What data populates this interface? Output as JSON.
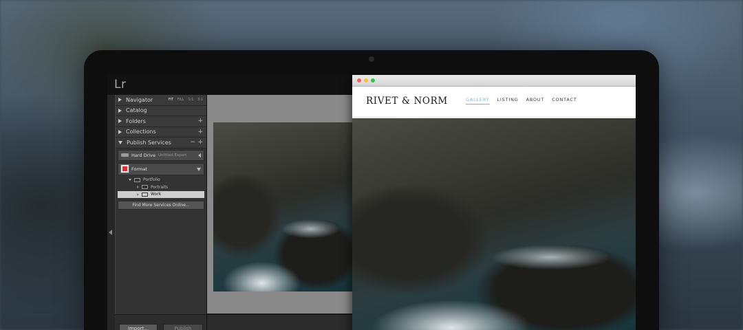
{
  "lightroom": {
    "logo": "Lr",
    "navigator": {
      "label": "Navigator",
      "options": [
        "FIT",
        "FILL",
        "1:1",
        "3:1"
      ]
    },
    "sections": [
      {
        "label": "Catalog",
        "action": ""
      },
      {
        "label": "Folders",
        "action": "+"
      },
      {
        "label": "Collections",
        "action": "+"
      }
    ],
    "publish": {
      "label": "Publish Services",
      "actions": [
        "−",
        "+"
      ],
      "hard_drive": {
        "name": "Hard Drive",
        "subtitle": "Untitled Export"
      },
      "format": {
        "name": "Format"
      },
      "tree": [
        {
          "label": "Portfolio",
          "level": 1,
          "selected": false
        },
        {
          "label": "Portraits",
          "level": 2,
          "selected": false
        },
        {
          "label": "Work",
          "level": 2,
          "selected": true
        }
      ],
      "find_more": "Find More Services Online..."
    },
    "buttons": {
      "import": "Import...",
      "publish": "Publish"
    }
  },
  "browser": {
    "traffic_colors": [
      "#fc605c",
      "#fdbc40",
      "#34c84a"
    ]
  },
  "site": {
    "logo": "RIVET & NORM",
    "nav": [
      {
        "label": "GALLERY",
        "active": true
      },
      {
        "label": "LISTING",
        "active": false
      },
      {
        "label": "ABOUT",
        "active": false
      },
      {
        "label": "CONTACT",
        "active": false
      }
    ]
  }
}
